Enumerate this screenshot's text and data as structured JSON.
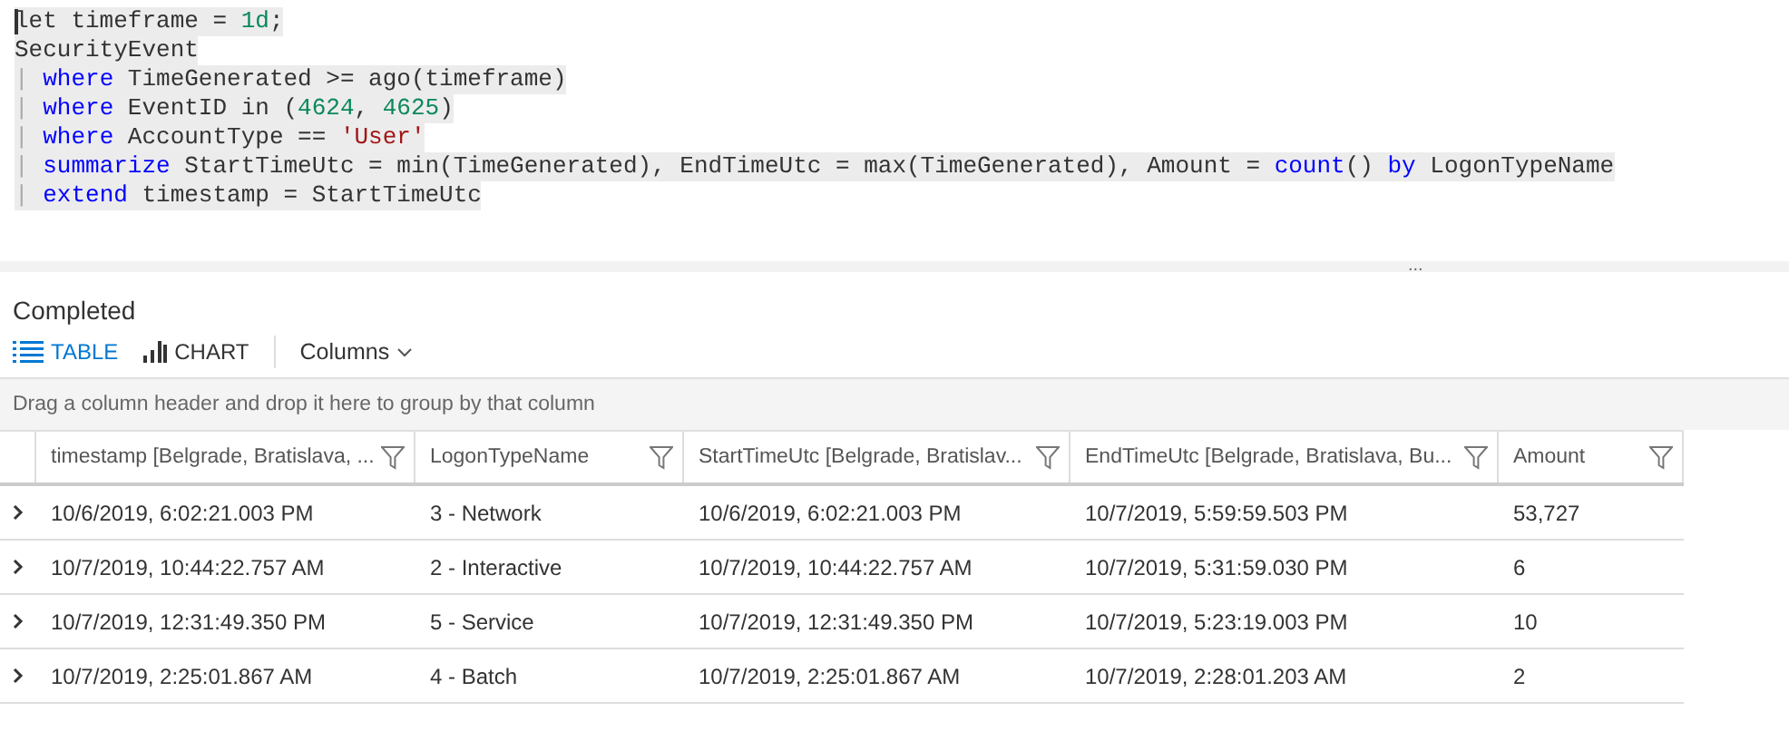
{
  "query_editor": {
    "lines": [
      {
        "tokens": [
          {
            "kind": "plain",
            "text": "let timeframe = "
          },
          {
            "kind": "number",
            "text": "1d"
          },
          {
            "kind": "plain",
            "text": ";"
          }
        ]
      },
      {
        "tokens": [
          {
            "kind": "plain",
            "text": "SecurityEvent"
          }
        ]
      },
      {
        "tokens": [
          {
            "kind": "pipe",
            "text": "| "
          },
          {
            "kind": "keyword",
            "text": "where"
          },
          {
            "kind": "plain",
            "text": " TimeGenerated >= ago(timeframe)"
          }
        ]
      },
      {
        "tokens": [
          {
            "kind": "pipe",
            "text": "| "
          },
          {
            "kind": "keyword",
            "text": "where"
          },
          {
            "kind": "plain",
            "text": " EventID in ("
          },
          {
            "kind": "number",
            "text": "4624"
          },
          {
            "kind": "plain",
            "text": ", "
          },
          {
            "kind": "number",
            "text": "4625"
          },
          {
            "kind": "plain",
            "text": ")"
          }
        ]
      },
      {
        "tokens": [
          {
            "kind": "pipe",
            "text": "| "
          },
          {
            "kind": "keyword",
            "text": "where"
          },
          {
            "kind": "plain",
            "text": " AccountType == "
          },
          {
            "kind": "string",
            "text": "'User'"
          }
        ]
      },
      {
        "tokens": [
          {
            "kind": "pipe",
            "text": "| "
          },
          {
            "kind": "keyword",
            "text": "summarize"
          },
          {
            "kind": "plain",
            "text": " StartTimeUtc = min(TimeGenerated), EndTimeUtc = max(TimeGenerated), Amount = "
          },
          {
            "kind": "keyword",
            "text": "count"
          },
          {
            "kind": "plain",
            "text": "() "
          },
          {
            "kind": "keyword",
            "text": "by"
          },
          {
            "kind": "plain",
            "text": " LogonTypeName"
          }
        ]
      },
      {
        "tokens": [
          {
            "kind": "pipe",
            "text": "| "
          },
          {
            "kind": "keyword",
            "text": "extend"
          },
          {
            "kind": "plain",
            "text": " timestamp = StartTimeUtc"
          }
        ]
      }
    ],
    "splitter": "..."
  },
  "status": "Completed",
  "view_tabs": [
    {
      "label": "TABLE",
      "selected": true
    },
    {
      "label": "CHART",
      "selected": false
    }
  ],
  "columns_menu": "Columns",
  "group_hint": "Drag a column header and drop it here to group by that column",
  "table": {
    "columns": [
      "timestamp [Belgrade, Bratislava, ...",
      "LogonTypeName",
      "StartTimeUtc [Belgrade, Bratislav...",
      "EndTimeUtc [Belgrade, Bratislava, Bu...",
      "Amount"
    ],
    "rows": [
      [
        "10/6/2019, 6:02:21.003 PM",
        "3 - Network",
        "10/6/2019, 6:02:21.003 PM",
        "10/7/2019, 5:59:59.503 PM",
        "53,727"
      ],
      [
        "10/7/2019, 10:44:22.757 AM",
        "2 - Interactive",
        "10/7/2019, 10:44:22.757 AM",
        "10/7/2019, 5:31:59.030 PM",
        "6"
      ],
      [
        "10/7/2019, 12:31:49.350 PM",
        "5 - Service",
        "10/7/2019, 12:31:49.350 PM",
        "10/7/2019, 5:23:19.003 PM",
        "10"
      ],
      [
        "10/7/2019, 2:25:01.867 AM",
        "4 - Batch",
        "10/7/2019, 2:25:01.867 AM",
        "10/7/2019, 2:28:01.203 AM",
        "2"
      ]
    ]
  }
}
